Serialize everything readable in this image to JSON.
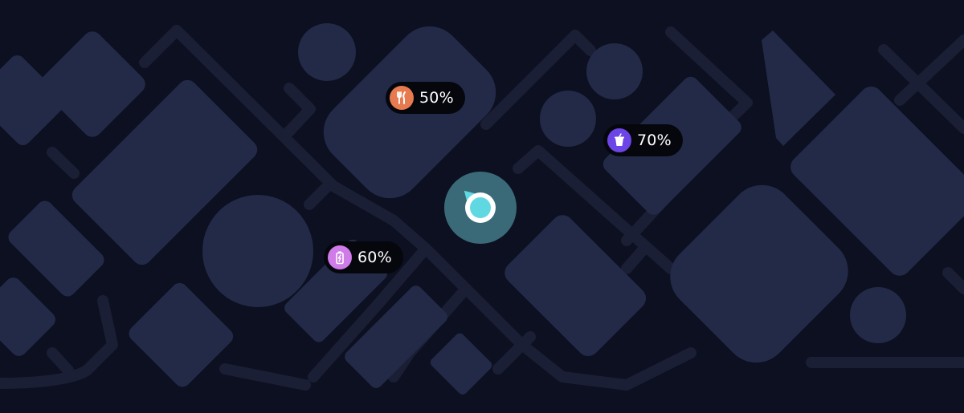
{
  "map": {
    "background": "#0c1020",
    "block_color": "#232a47",
    "road_color": "#1a1f35"
  },
  "user_location": {
    "halo_color": "#3a6a78",
    "ring_color": "#ffffff",
    "core_color": "#5fd8e2"
  },
  "pins": [
    {
      "name": "restaurant",
      "icon": "fork-knife-icon",
      "color": "#e77a4e",
      "label": "50%"
    },
    {
      "name": "drinks",
      "icon": "cup-icon",
      "color": "#6b45e6",
      "label": "70%"
    },
    {
      "name": "battery",
      "icon": "battery-icon",
      "color": "#cf7be8",
      "label": "60%"
    }
  ]
}
